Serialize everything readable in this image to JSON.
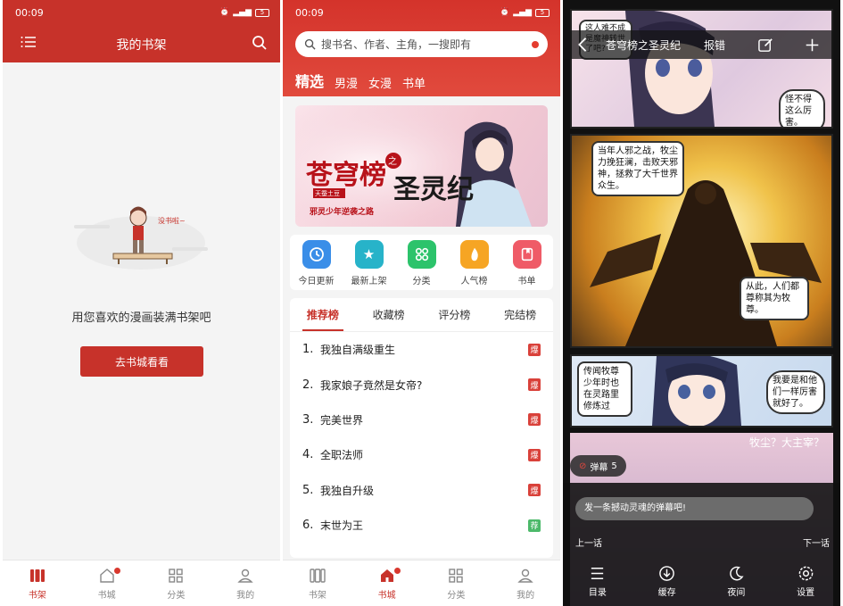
{
  "status_bar": {
    "time": "00:09",
    "battery": "5"
  },
  "panel1": {
    "title": "我的书架",
    "empty_text": "用您喜欢的漫画装满书架吧",
    "illustration_bubble": "没书啦~",
    "go_button": "去书城看看",
    "tabs": [
      {
        "label": "书架",
        "active": true
      },
      {
        "label": "书城",
        "active": false,
        "dot": true
      },
      {
        "label": "分类",
        "active": false
      },
      {
        "label": "我的",
        "active": false
      }
    ]
  },
  "panel2": {
    "search_placeholder": "搜书名、作者、主角，一搜即有",
    "categories": [
      "精选",
      "男漫",
      "女漫",
      "书单"
    ],
    "banner": {
      "title_left": "苍穹榜",
      "title_zhi": "之",
      "title_right": "圣灵纪",
      "tagline": "邪灵少年逆袭之路",
      "stamp": "天蚕土豆"
    },
    "quick_icons": [
      {
        "label": "今日更新",
        "icon": "clock-icon",
        "color": "#3a8ee8"
      },
      {
        "label": "最新上架",
        "icon": "star-box-icon",
        "color": "#27b3c9"
      },
      {
        "label": "分类",
        "icon": "grid-icon",
        "color": "#2cc36b"
      },
      {
        "label": "人气榜",
        "icon": "flame-icon",
        "color": "#f6a524"
      },
      {
        "label": "书单",
        "icon": "book-icon",
        "color": "#ef5b67"
      }
    ],
    "rank_tabs": [
      "推荐榜",
      "收藏榜",
      "评分榜",
      "完结榜"
    ],
    "rank_items": [
      {
        "num": "1.",
        "name": "我独自满级重生",
        "badge": "爆",
        "badge_color": "#d9413a"
      },
      {
        "num": "2.",
        "name": "我家娘子竟然是女帝?",
        "badge": "爆",
        "badge_color": "#d9413a"
      },
      {
        "num": "3.",
        "name": "完美世界",
        "badge": "爆",
        "badge_color": "#d9413a"
      },
      {
        "num": "4.",
        "name": "全职法师",
        "badge": "爆",
        "badge_color": "#d9413a"
      },
      {
        "num": "5.",
        "name": "我独自升级",
        "badge": "爆",
        "badge_color": "#d9413a"
      },
      {
        "num": "6.",
        "name": "末世为王",
        "badge": "荐",
        "badge_color": "#4cb96a"
      }
    ],
    "tabs": [
      {
        "label": "书架",
        "active": false
      },
      {
        "label": "书城",
        "active": true,
        "dot": true
      },
      {
        "label": "分类",
        "active": false
      },
      {
        "label": "我的",
        "active": false
      }
    ]
  },
  "panel3": {
    "title": "苍穹榜之圣灵纪",
    "report": "报错",
    "bubbles": {
      "b1": "这人难不成是魔神转世了吧?",
      "b2": "怪不得这么厉害。",
      "b3": "当年人邪之战，牧尘力挽狂澜，击败天邪神，拯救了大千世界众生。",
      "b4": "从此，人们都尊称其为牧尊。",
      "b5": "传闻牧尊少年时也在灵路里修炼过",
      "b6": "我要是和他们一样厉害就好了。",
      "b7": "牧尘？大主宰？"
    },
    "danmu_label": "弹幕",
    "danmu_count": "5",
    "danmu_placeholder": "发一条撼动灵魂的弹幕吧!",
    "prev_chapter": "上一话",
    "next_chapter": "下一话",
    "tools": [
      {
        "label": "目录",
        "icon": "list-icon"
      },
      {
        "label": "缓存",
        "icon": "download-icon"
      },
      {
        "label": "夜间",
        "icon": "moon-icon"
      },
      {
        "label": "设置",
        "icon": "settings-icon"
      }
    ]
  }
}
